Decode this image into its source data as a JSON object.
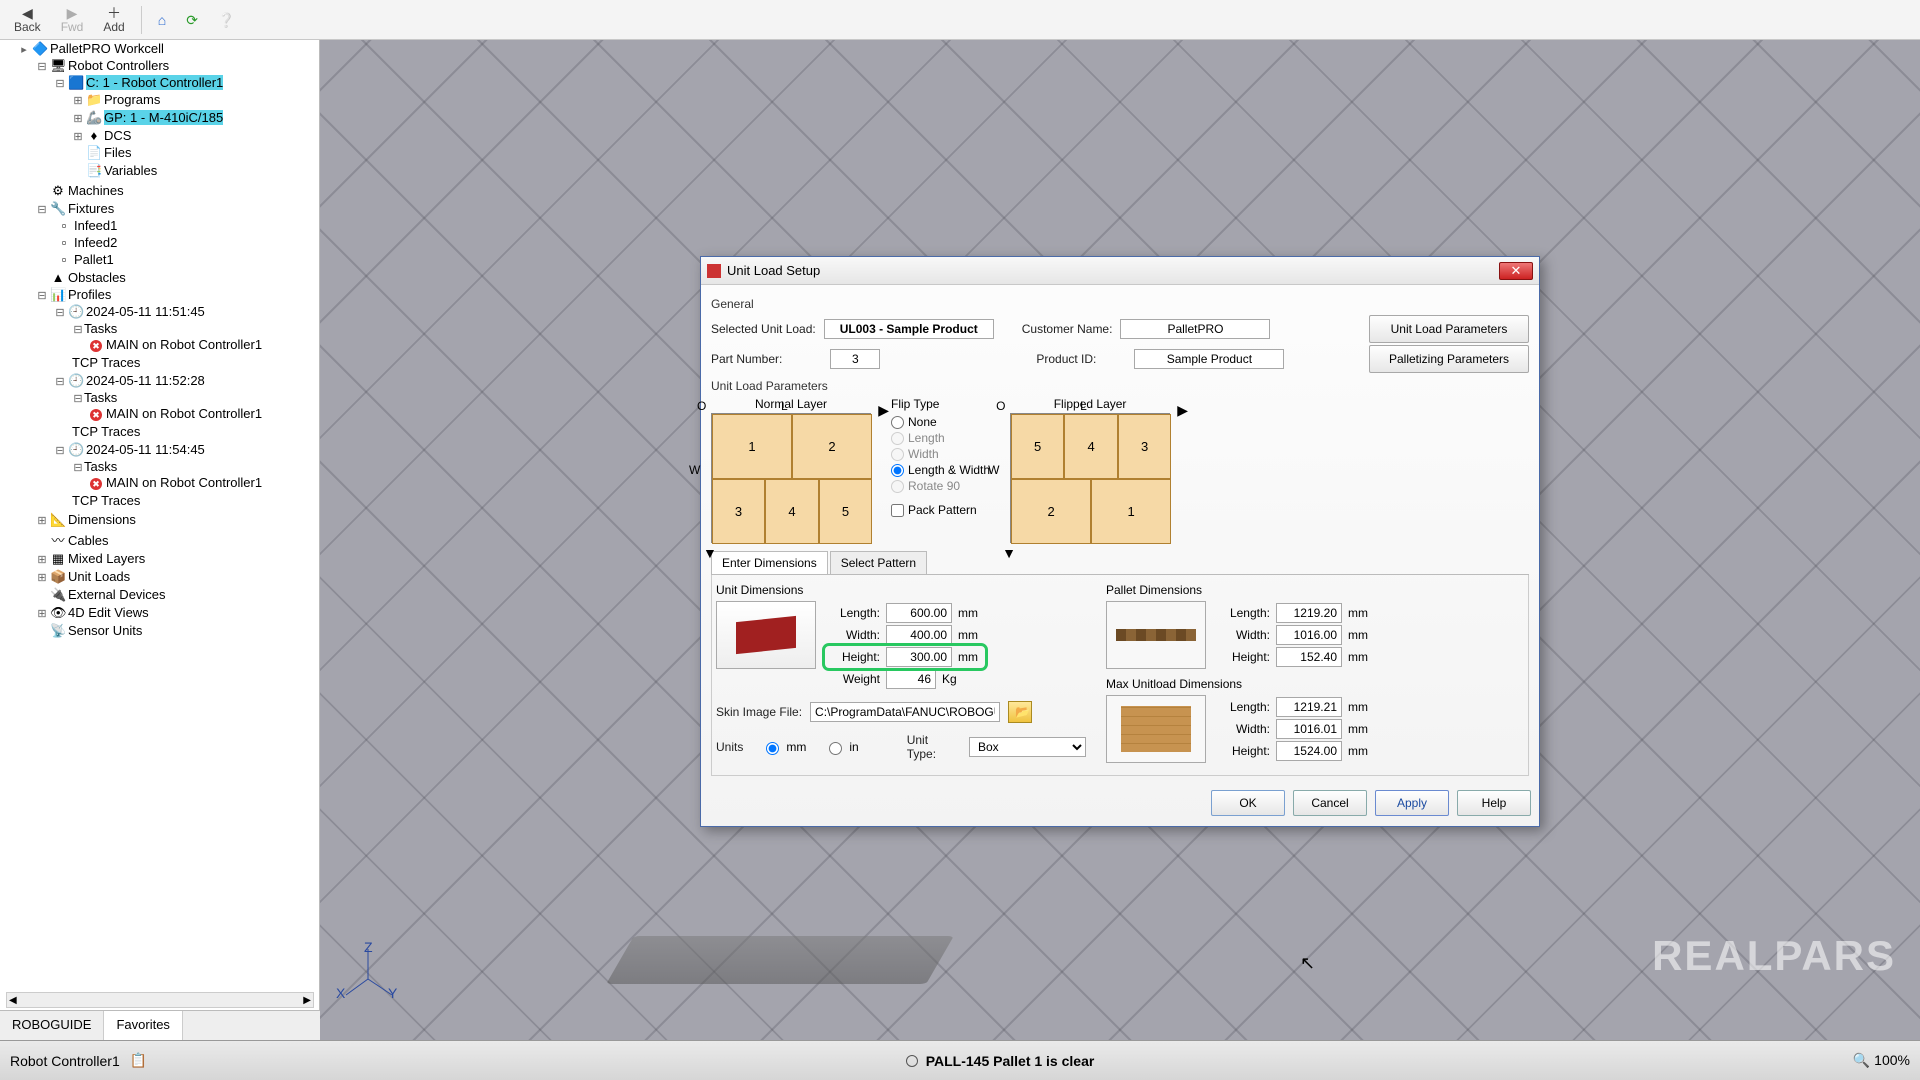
{
  "toolbar": {
    "back": "Back",
    "fwd": "Fwd",
    "add": "Add"
  },
  "tree": {
    "root": "PalletPRO Workcell",
    "robot_controllers": "Robot Controllers",
    "controller1": "C: 1 - Robot Controller1",
    "programs": "Programs",
    "gp1": "GP: 1 - M-410iC/185",
    "dcs": "DCS",
    "files": "Files",
    "variables": "Variables",
    "machines": "Machines",
    "fixtures": "Fixtures",
    "infeed1": "Infeed1",
    "infeed2": "Infeed2",
    "pallet1": "Pallet1",
    "obstacles": "Obstacles",
    "profiles": "Profiles",
    "prof1": "2024-05-11 11:51:45",
    "prof2": "2024-05-11 11:52:28",
    "prof3": "2024-05-11 11:54:45",
    "tasks": "Tasks",
    "main_on": "MAIN on Robot Controller1",
    "tcp_traces": "TCP Traces",
    "dimensions": "Dimensions",
    "cables": "Cables",
    "mixed_layers": "Mixed Layers",
    "unit_loads": "Unit Loads",
    "external_devices": "External Devices",
    "edit_views": "4D Edit Views",
    "sensor_units": "Sensor Units"
  },
  "bottom_tabs": {
    "t1": "ROBOGUIDE",
    "t2": "Favorites"
  },
  "status": {
    "left": "Robot Controller1",
    "msg": "PALL-145 Pallet 1 is clear",
    "zoom": "100%"
  },
  "watermark": "REALPARS",
  "dialog": {
    "title": "Unit Load Setup",
    "general": "General",
    "selected_ul_lbl": "Selected Unit Load:",
    "selected_ul": "UL003 - Sample Product",
    "customer_lbl": "Customer Name:",
    "customer": "PalletPRO",
    "part_lbl": "Part Number:",
    "part": "3",
    "product_lbl": "Product ID:",
    "product": "Sample Product",
    "btn_ulp": "Unit Load Parameters",
    "btn_pp": "Palletizing Parameters",
    "section_ulp": "Unit Load Parameters",
    "normal_layer": "Normal Layer",
    "flipped_layer": "Flipped Layer",
    "normal_cells": [
      "1",
      "2",
      "3",
      "4",
      "5"
    ],
    "flipped_cells": [
      "5",
      "4",
      "3",
      "2",
      "1"
    ],
    "flip": {
      "title": "Flip Type",
      "none": "None",
      "length": "Length",
      "width": "Width",
      "lw": "Length & Width",
      "rotate": "Rotate 90",
      "pack": "Pack Pattern"
    },
    "tab_enter": "Enter Dimensions",
    "tab_select": "Select Pattern",
    "unit_dims": {
      "title": "Unit Dimensions",
      "length_lbl": "Length:",
      "length": "600.00",
      "width_lbl": "Width:",
      "width": "400.00",
      "height_lbl": "Height:",
      "height": "300.00",
      "weight_lbl": "Weight",
      "weight": "46",
      "mm": "mm",
      "kg": "Kg"
    },
    "pallet_dims": {
      "title": "Pallet Dimensions",
      "length": "1219.20",
      "width": "1016.00",
      "height": "152.40"
    },
    "max_dims": {
      "title": "Max Unitload Dimensions",
      "length": "1219.21",
      "width": "1016.01",
      "height": "1524.00"
    },
    "generic": {
      "length_lbl": "Length:",
      "width_lbl": "Width:",
      "height_lbl": "Height:",
      "mm": "mm"
    },
    "skin_lbl": "Skin Image File:",
    "skin_path": "C:\\ProgramData\\FANUC\\ROBOGU",
    "units_lbl": "Units",
    "unit_mm": "mm",
    "unit_in": "in",
    "unit_type_lbl": "Unit Type:",
    "unit_type": "Box",
    "ok": "OK",
    "cancel": "Cancel",
    "apply": "Apply",
    "help": "Help"
  },
  "axes": {
    "O": "O",
    "L": "L",
    "W": "W"
  },
  "gizmo": {
    "x": "X",
    "y": "Y",
    "z": "Z"
  }
}
